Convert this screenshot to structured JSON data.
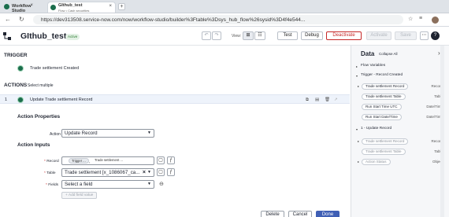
{
  "browser": {
    "tabs": [
      {
        "label": "Workflow Studio"
      },
      {
        "label": "GIthub_test",
        "sublabel": "Flow • Cash securities"
      }
    ],
    "url": "https://dev313508.service-now.com/now/workflow-studio/builder%3Ftable%3Dsys_hub_flow%26sysid%3D4f4e544..."
  },
  "app": {
    "title": "GIthub_test",
    "status": "Active",
    "view_label": "View:",
    "buttons": {
      "test": "Test",
      "debug": "Debug",
      "deactivate": "Deactivate",
      "activate": "Activate",
      "save": "Save"
    }
  },
  "trigger": {
    "heading": "TRIGGER",
    "name": "Trade settlement Created"
  },
  "actions": {
    "heading": "ACTIONS",
    "select_multiple": "Select multiple",
    "item_number": "1",
    "item_name": "Update Trade settlement Record",
    "properties_heading": "Action Properties",
    "action_label": "Action",
    "action_value": "Update Record",
    "inputs_heading": "Action Inputs",
    "record_label": "Record",
    "record_pills": [
      "Trigger ...",
      "Trade settlement ..."
    ],
    "table_label": "Table",
    "table_value": "Trade settlement [x_1086067_ca...",
    "fields_label": "Fields",
    "fields_placeholder": "Select a field",
    "add_field_value": "+ Add field value"
  },
  "footer": {
    "delete": "Delete",
    "cancel": "Cancel",
    "done": "Done"
  },
  "data_panel": {
    "title": "Data",
    "collapse_all": "Collapse All",
    "sections": {
      "flow_variables": "Flow Variables",
      "trigger": "Trigger - Record Created",
      "update": "1 - Update Record"
    },
    "trigger_items": [
      {
        "label": "Trade settlement Record",
        "type": "Record"
      },
      {
        "label": "Trade settlement Table",
        "type": "Table"
      },
      {
        "label": "Run Start Time UTC",
        "type": "Date/Time"
      },
      {
        "label": "Run Start Date/Time",
        "type": "Date/Time"
      }
    ],
    "update_items": [
      {
        "label": "Trade settlement Record",
        "type": "Record"
      },
      {
        "label": "Trade settlement Table",
        "type": "Table"
      },
      {
        "label": "Action Status",
        "type": "Object"
      }
    ]
  },
  "colors": {
    "accent": "#3f5fb5",
    "trigger_green": "#1b6e4c",
    "deactivate_red": "#c62828"
  }
}
